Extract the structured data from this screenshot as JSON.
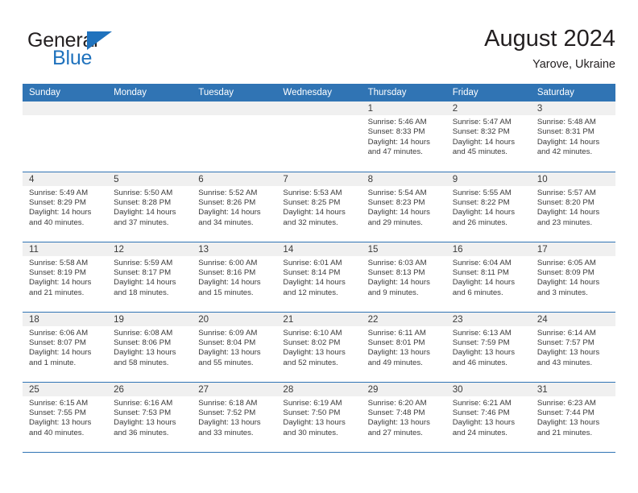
{
  "brand": {
    "word_general": "General",
    "word_blue": "Blue",
    "flag_icon": "triangle-flag-icon",
    "accent_color": "#1f72bd"
  },
  "header": {
    "title": "August 2024",
    "location": "Yarove, Ukraine"
  },
  "calendar": {
    "header_color": "#3074b4",
    "daynum_band_color": "#f0f0f0",
    "weekday_headers": [
      "Sunday",
      "Monday",
      "Tuesday",
      "Wednesday",
      "Thursday",
      "Friday",
      "Saturday"
    ],
    "weeks": [
      [
        {
          "day": "",
          "empty": true
        },
        {
          "day": "",
          "empty": true
        },
        {
          "day": "",
          "empty": true
        },
        {
          "day": "",
          "empty": true
        },
        {
          "day": "1",
          "sunrise": "Sunrise: 5:46 AM",
          "sunset": "Sunset: 8:33 PM",
          "daylight_1": "Daylight: 14 hours",
          "daylight_2": "and 47 minutes."
        },
        {
          "day": "2",
          "sunrise": "Sunrise: 5:47 AM",
          "sunset": "Sunset: 8:32 PM",
          "daylight_1": "Daylight: 14 hours",
          "daylight_2": "and 45 minutes."
        },
        {
          "day": "3",
          "sunrise": "Sunrise: 5:48 AM",
          "sunset": "Sunset: 8:31 PM",
          "daylight_1": "Daylight: 14 hours",
          "daylight_2": "and 42 minutes."
        }
      ],
      [
        {
          "day": "4",
          "sunrise": "Sunrise: 5:49 AM",
          "sunset": "Sunset: 8:29 PM",
          "daylight_1": "Daylight: 14 hours",
          "daylight_2": "and 40 minutes."
        },
        {
          "day": "5",
          "sunrise": "Sunrise: 5:50 AM",
          "sunset": "Sunset: 8:28 PM",
          "daylight_1": "Daylight: 14 hours",
          "daylight_2": "and 37 minutes."
        },
        {
          "day": "6",
          "sunrise": "Sunrise: 5:52 AM",
          "sunset": "Sunset: 8:26 PM",
          "daylight_1": "Daylight: 14 hours",
          "daylight_2": "and 34 minutes."
        },
        {
          "day": "7",
          "sunrise": "Sunrise: 5:53 AM",
          "sunset": "Sunset: 8:25 PM",
          "daylight_1": "Daylight: 14 hours",
          "daylight_2": "and 32 minutes."
        },
        {
          "day": "8",
          "sunrise": "Sunrise: 5:54 AM",
          "sunset": "Sunset: 8:23 PM",
          "daylight_1": "Daylight: 14 hours",
          "daylight_2": "and 29 minutes."
        },
        {
          "day": "9",
          "sunrise": "Sunrise: 5:55 AM",
          "sunset": "Sunset: 8:22 PM",
          "daylight_1": "Daylight: 14 hours",
          "daylight_2": "and 26 minutes."
        },
        {
          "day": "10",
          "sunrise": "Sunrise: 5:57 AM",
          "sunset": "Sunset: 8:20 PM",
          "daylight_1": "Daylight: 14 hours",
          "daylight_2": "and 23 minutes."
        }
      ],
      [
        {
          "day": "11",
          "sunrise": "Sunrise: 5:58 AM",
          "sunset": "Sunset: 8:19 PM",
          "daylight_1": "Daylight: 14 hours",
          "daylight_2": "and 21 minutes."
        },
        {
          "day": "12",
          "sunrise": "Sunrise: 5:59 AM",
          "sunset": "Sunset: 8:17 PM",
          "daylight_1": "Daylight: 14 hours",
          "daylight_2": "and 18 minutes."
        },
        {
          "day": "13",
          "sunrise": "Sunrise: 6:00 AM",
          "sunset": "Sunset: 8:16 PM",
          "daylight_1": "Daylight: 14 hours",
          "daylight_2": "and 15 minutes."
        },
        {
          "day": "14",
          "sunrise": "Sunrise: 6:01 AM",
          "sunset": "Sunset: 8:14 PM",
          "daylight_1": "Daylight: 14 hours",
          "daylight_2": "and 12 minutes."
        },
        {
          "day": "15",
          "sunrise": "Sunrise: 6:03 AM",
          "sunset": "Sunset: 8:13 PM",
          "daylight_1": "Daylight: 14 hours",
          "daylight_2": "and 9 minutes."
        },
        {
          "day": "16",
          "sunrise": "Sunrise: 6:04 AM",
          "sunset": "Sunset: 8:11 PM",
          "daylight_1": "Daylight: 14 hours",
          "daylight_2": "and 6 minutes."
        },
        {
          "day": "17",
          "sunrise": "Sunrise: 6:05 AM",
          "sunset": "Sunset: 8:09 PM",
          "daylight_1": "Daylight: 14 hours",
          "daylight_2": "and 3 minutes."
        }
      ],
      [
        {
          "day": "18",
          "sunrise": "Sunrise: 6:06 AM",
          "sunset": "Sunset: 8:07 PM",
          "daylight_1": "Daylight: 14 hours",
          "daylight_2": "and 1 minute."
        },
        {
          "day": "19",
          "sunrise": "Sunrise: 6:08 AM",
          "sunset": "Sunset: 8:06 PM",
          "daylight_1": "Daylight: 13 hours",
          "daylight_2": "and 58 minutes."
        },
        {
          "day": "20",
          "sunrise": "Sunrise: 6:09 AM",
          "sunset": "Sunset: 8:04 PM",
          "daylight_1": "Daylight: 13 hours",
          "daylight_2": "and 55 minutes."
        },
        {
          "day": "21",
          "sunrise": "Sunrise: 6:10 AM",
          "sunset": "Sunset: 8:02 PM",
          "daylight_1": "Daylight: 13 hours",
          "daylight_2": "and 52 minutes."
        },
        {
          "day": "22",
          "sunrise": "Sunrise: 6:11 AM",
          "sunset": "Sunset: 8:01 PM",
          "daylight_1": "Daylight: 13 hours",
          "daylight_2": "and 49 minutes."
        },
        {
          "day": "23",
          "sunrise": "Sunrise: 6:13 AM",
          "sunset": "Sunset: 7:59 PM",
          "daylight_1": "Daylight: 13 hours",
          "daylight_2": "and 46 minutes."
        },
        {
          "day": "24",
          "sunrise": "Sunrise: 6:14 AM",
          "sunset": "Sunset: 7:57 PM",
          "daylight_1": "Daylight: 13 hours",
          "daylight_2": "and 43 minutes."
        }
      ],
      [
        {
          "day": "25",
          "sunrise": "Sunrise: 6:15 AM",
          "sunset": "Sunset: 7:55 PM",
          "daylight_1": "Daylight: 13 hours",
          "daylight_2": "and 40 minutes."
        },
        {
          "day": "26",
          "sunrise": "Sunrise: 6:16 AM",
          "sunset": "Sunset: 7:53 PM",
          "daylight_1": "Daylight: 13 hours",
          "daylight_2": "and 36 minutes."
        },
        {
          "day": "27",
          "sunrise": "Sunrise: 6:18 AM",
          "sunset": "Sunset: 7:52 PM",
          "daylight_1": "Daylight: 13 hours",
          "daylight_2": "and 33 minutes."
        },
        {
          "day": "28",
          "sunrise": "Sunrise: 6:19 AM",
          "sunset": "Sunset: 7:50 PM",
          "daylight_1": "Daylight: 13 hours",
          "daylight_2": "and 30 minutes."
        },
        {
          "day": "29",
          "sunrise": "Sunrise: 6:20 AM",
          "sunset": "Sunset: 7:48 PM",
          "daylight_1": "Daylight: 13 hours",
          "daylight_2": "and 27 minutes."
        },
        {
          "day": "30",
          "sunrise": "Sunrise: 6:21 AM",
          "sunset": "Sunset: 7:46 PM",
          "daylight_1": "Daylight: 13 hours",
          "daylight_2": "and 24 minutes."
        },
        {
          "day": "31",
          "sunrise": "Sunrise: 6:23 AM",
          "sunset": "Sunset: 7:44 PM",
          "daylight_1": "Daylight: 13 hours",
          "daylight_2": "and 21 minutes."
        }
      ]
    ]
  }
}
